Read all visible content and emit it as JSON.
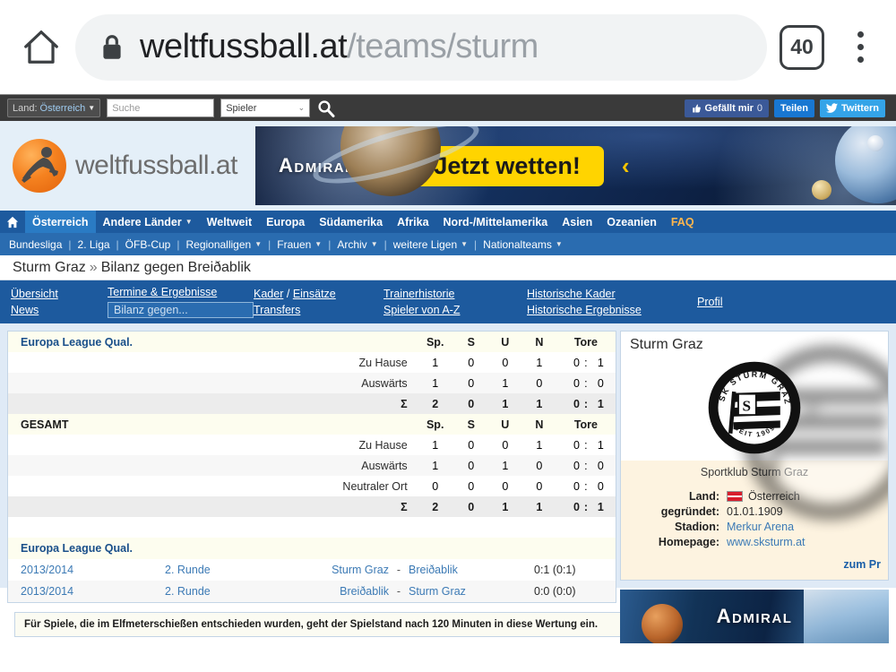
{
  "browser": {
    "home_icon": "home-icon",
    "lock_icon": "lock-icon",
    "url_domain": "weltfussball.at",
    "url_path": "/teams/sturm",
    "tab_count": "40",
    "menu_icon": "kebab-menu-icon"
  },
  "topbar": {
    "country_label": "Land:",
    "country_value": "Österreich",
    "search_placeholder": "Suche",
    "search_value": "",
    "player_select": "Spieler",
    "search_icon": "magnifier-icon",
    "social": {
      "like_label": "Gefällt mir",
      "like_count": "0",
      "share_label": "Teilen",
      "tweet_label": "Twittern"
    }
  },
  "header": {
    "logo_text": "weltfussball.at",
    "ad": {
      "brand": "Admiral",
      "cta": "Jetzt wetten!",
      "chevron_right": "›",
      "chevron_left": "‹"
    }
  },
  "mainnav": {
    "home_icon": "house-icon",
    "items": [
      {
        "label": "Österreich",
        "active": true,
        "dropdown": false
      },
      {
        "label": "Andere Länder",
        "active": false,
        "dropdown": true
      },
      {
        "label": "Weltweit",
        "active": false,
        "dropdown": false
      },
      {
        "label": "Europa",
        "active": false,
        "dropdown": false
      },
      {
        "label": "Südamerika",
        "active": false,
        "dropdown": false
      },
      {
        "label": "Afrika",
        "active": false,
        "dropdown": false
      },
      {
        "label": "Nord-/Mittelamerika",
        "active": false,
        "dropdown": false
      },
      {
        "label": "Asien",
        "active": false,
        "dropdown": false
      },
      {
        "label": "Ozeanien",
        "active": false,
        "dropdown": false
      },
      {
        "label": "FAQ",
        "active": false,
        "dropdown": false
      }
    ]
  },
  "subnav": {
    "items": [
      {
        "label": "Bundesliga",
        "dropdown": false
      },
      {
        "label": "2. Liga",
        "dropdown": false
      },
      {
        "label": "ÖFB-Cup",
        "dropdown": false
      },
      {
        "label": "Regionalligen",
        "dropdown": true
      },
      {
        "label": "Frauen",
        "dropdown": true
      },
      {
        "label": "Archiv",
        "dropdown": true
      },
      {
        "label": "weitere Ligen",
        "dropdown": true
      },
      {
        "label": "Nationalteams",
        "dropdown": true
      }
    ]
  },
  "breadcrumb": {
    "team": "Sturm Graz",
    "separator": "»",
    "page": "Bilanz gegen Breiðablik"
  },
  "tabs": {
    "col1": [
      "Übersicht",
      "News"
    ],
    "col2_top": "Termine & Ergebnisse",
    "col2_active": "Bilanz gegen...",
    "col3": [
      "Kader",
      "Einsätze",
      "Transfers"
    ],
    "col3_sep": "/",
    "col4": [
      "Trainerhistorie",
      "Spieler von A-Z"
    ],
    "col5": [
      "Historische Kader",
      "Historische Ergebnisse"
    ],
    "col6": [
      "Profil"
    ]
  },
  "stats": {
    "columns": [
      "Sp.",
      "S",
      "U",
      "N",
      "Tore"
    ],
    "sections": [
      {
        "title": "Europa League Qual.",
        "rows": [
          {
            "label": "Zu Hause",
            "sp": "1",
            "s": "0",
            "u": "0",
            "n": "1",
            "g1": "0",
            "sep": ":",
            "g2": "1",
            "type": "normal"
          },
          {
            "label": "Auswärts",
            "sp": "1",
            "s": "0",
            "u": "1",
            "n": "0",
            "g1": "0",
            "sep": ":",
            "g2": "0",
            "type": "normal"
          },
          {
            "label": "Σ",
            "sp": "2",
            "s": "0",
            "u": "1",
            "n": "1",
            "g1": "0",
            "sep": ":",
            "g2": "1",
            "type": "sum"
          }
        ]
      },
      {
        "title": "GESAMT",
        "rows": [
          {
            "label": "Zu Hause",
            "sp": "1",
            "s": "0",
            "u": "0",
            "n": "1",
            "g1": "0",
            "sep": ":",
            "g2": "1",
            "type": "normal"
          },
          {
            "label": "Auswärts",
            "sp": "1",
            "s": "0",
            "u": "1",
            "n": "0",
            "g1": "0",
            "sep": ":",
            "g2": "0",
            "type": "normal"
          },
          {
            "label": "Neutraler Ort",
            "sp": "0",
            "s": "0",
            "u": "0",
            "n": "0",
            "g1": "0",
            "sep": ":",
            "g2": "0",
            "type": "normal"
          },
          {
            "label": "Σ",
            "sp": "2",
            "s": "0",
            "u": "1",
            "n": "1",
            "g1": "0",
            "sep": ":",
            "g2": "1",
            "type": "sum"
          }
        ]
      }
    ]
  },
  "matches": {
    "section_title": "Europa League Qual.",
    "rows": [
      {
        "season": "2013/2014",
        "round": "2. Runde",
        "home": "Sturm Graz",
        "dash": "-",
        "away": "Breiðablik",
        "score": "0:1 (0:1)"
      },
      {
        "season": "2013/2014",
        "round": "2. Runde",
        "home": "Breiðablik",
        "dash": "-",
        "away": "Sturm Graz",
        "score": "0:0 (0:0)"
      }
    ]
  },
  "footnote": "Für Spiele, die im Elfmeterschießen entschieden wurden, geht der Spielstand nach 120 Minuten in diese Wertung ein.",
  "club": {
    "title": "Sturm Graz",
    "crest_alt": "sk-sturm-graz-crest",
    "full_name": "Sportklub Sturm Graz",
    "info": [
      {
        "label": "Land:",
        "value": "Österreich",
        "flag": true,
        "link": false
      },
      {
        "label": "gegründet:",
        "value": "01.01.1909",
        "flag": false,
        "link": false
      },
      {
        "label": "Stadion:",
        "value": "Merkur Arena",
        "flag": false,
        "link": true
      },
      {
        "label": "Homepage:",
        "value": "www.sksturm.at",
        "flag": false,
        "link": true
      }
    ],
    "profile_link": "zum Pr",
    "ad_brand": "Admiral"
  }
}
